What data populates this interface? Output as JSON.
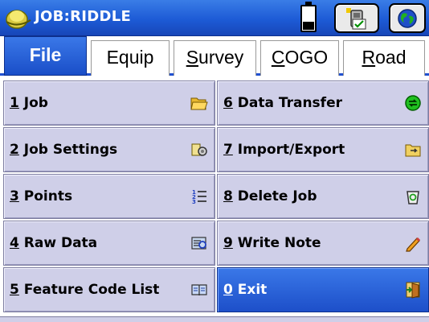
{
  "title": "JOB:RIDDLE",
  "status": {
    "battery_level": 0.35
  },
  "tabs": [
    {
      "label": "File",
      "ul": "",
      "rest": "File",
      "active": true
    },
    {
      "label": "Equip",
      "ul": "",
      "rest": "Equip",
      "active": false
    },
    {
      "label": "Survey",
      "ul": "S",
      "rest": "urvey",
      "active": false
    },
    {
      "label": "COGO",
      "ul": "C",
      "rest": "OGO",
      "active": false
    },
    {
      "label": "Road",
      "ul": "R",
      "rest": "oad",
      "active": false
    }
  ],
  "menu": [
    {
      "num": "1",
      "label": "Job",
      "icon": "folder-open-icon"
    },
    {
      "num": "6",
      "label": "Data Transfer",
      "icon": "transfer-icon"
    },
    {
      "num": "2",
      "label": "Job Settings",
      "icon": "settings-icon"
    },
    {
      "num": "7",
      "label": "Import/Export",
      "icon": "import-export-icon"
    },
    {
      "num": "3",
      "label": "Points",
      "icon": "points-list-icon"
    },
    {
      "num": "8",
      "label": "Delete Job",
      "icon": "trash-icon"
    },
    {
      "num": "4",
      "label": "Raw Data",
      "icon": "raw-data-icon"
    },
    {
      "num": "9",
      "label": "Write Note",
      "icon": "pencil-icon"
    },
    {
      "num": "5",
      "label": "Feature Code List",
      "icon": "book-icon"
    },
    {
      "num": "0",
      "label": "Exit",
      "icon": "exit-door-icon",
      "selected": true
    }
  ],
  "colors": {
    "accent": "#1d5bd6",
    "button": "#cfcfe8"
  }
}
